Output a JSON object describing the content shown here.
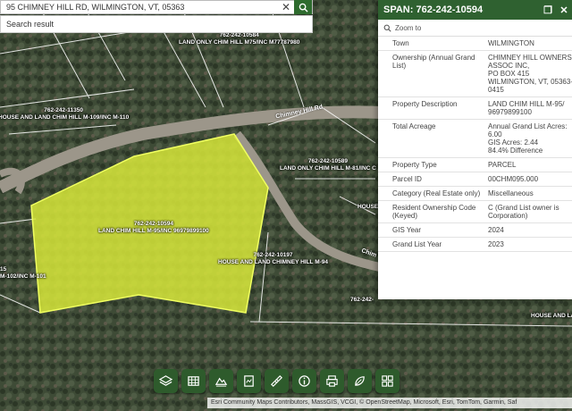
{
  "search": {
    "query": "95 CHIMNEY HILL RD, WILMINGTON, VT, 05363",
    "result_label": "Search result"
  },
  "map": {
    "road_label": "Chimney Hill Rd",
    "road_label_2": "Chim",
    "parcel_labels": [
      {
        "id": "762-242-10584",
        "desc": "LAND ONLY CHIM HILL M75/INC M77787980"
      },
      {
        "id": "762-242-11350",
        "desc": "HOUSE AND LAND CHIM HILL M-109/INC M-110"
      },
      {
        "id": "762-242-10589",
        "desc": "LAND ONLY CHIM HILL M-81/INC C"
      },
      {
        "id": "762-242-10594",
        "desc": "LAND CHIM HILL M-95/INC 96979899100"
      },
      {
        "id": "762-242-10197",
        "desc": "HOUSE AND LAND CHIMNEY HILL M-94"
      },
      {
        "id": "15",
        "desc": "M-102/INC M-101"
      },
      {
        "id": "762-242-",
        "desc": ""
      },
      {
        "id": "HOUSE",
        "desc": ""
      },
      {
        "id": "HOUSE AND LA",
        "desc": ""
      }
    ],
    "colors": {
      "highlight": "#d7e83a",
      "forest": "#3f4c37",
      "panel_header": "#2f6130"
    }
  },
  "panel": {
    "title": "SPAN: 762-242-10594",
    "zoom_label": "Zoom to",
    "rows": [
      {
        "key": "Town",
        "value": "WILMINGTON"
      },
      {
        "key": "Ownership (Annual Grand List)",
        "value": "CHIMNEY HILL OWNERS\nASSOC INC,\nPO BOX 415\nWILMINGTON, VT, 05363-\n0415"
      },
      {
        "key": "Property Description",
        "value": "LAND CHIM HILL M-95/\n96979899100"
      },
      {
        "key": "Total Acreage",
        "value": "Annual Grand List Acres:\n6.00\nGIS Acres: 2.44\n84.4% Difference"
      },
      {
        "key": "Property Type",
        "value": "PARCEL"
      },
      {
        "key": "Parcel ID",
        "value": "00CHM095.000"
      },
      {
        "key": "Category (Real Estate only)",
        "value": "Miscellaneous"
      },
      {
        "key": "Resident Ownership Code (Keyed)",
        "value": "C (Grand List owner is\nCorporation)"
      },
      {
        "key": "GIS Year",
        "value": "2024"
      },
      {
        "key": "Grand List Year",
        "value": "2023"
      }
    ]
  },
  "toolbar": {
    "icons": [
      "layers-icon",
      "table-icon",
      "basemap-icon",
      "print-map-icon",
      "measure-icon",
      "info-icon",
      "print-icon",
      "legend-icon",
      "grid-icon"
    ]
  },
  "attribution": "Esri Community Maps Contributors, MassGIS, VCGI, © OpenStreetMap, Microsoft, Esri, TomTom, Garmin, Saf"
}
